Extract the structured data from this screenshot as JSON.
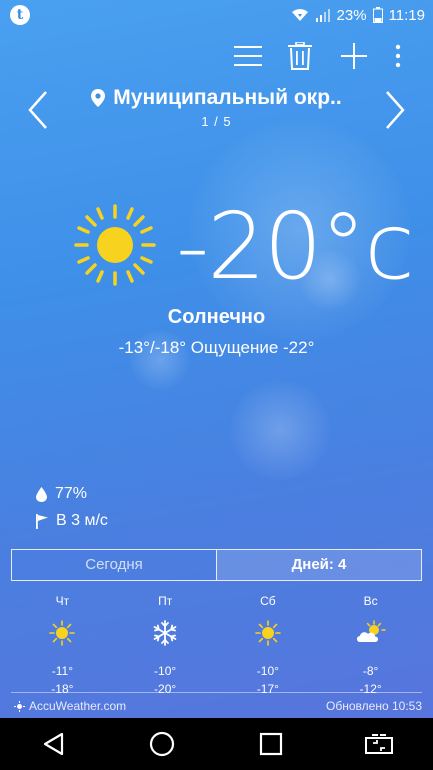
{
  "status_bar": {
    "app_badge": "t",
    "battery": "23%",
    "time": "11:19"
  },
  "location": {
    "name": "Муниципальный окр..",
    "page": "1 / 5"
  },
  "current": {
    "temperature": "-20°c",
    "condition": "Солнечно",
    "min_max_feel": "-13°/-18° Ощущение -22°",
    "humidity": "77%",
    "wind": "В 3 м/с"
  },
  "tabs": {
    "today": "Сегодня",
    "days": "Дней: 4"
  },
  "forecast": [
    {
      "day": "Чт",
      "icon": "sun-icon",
      "hi": "-11°",
      "lo": "-18°"
    },
    {
      "day": "Пт",
      "icon": "snowflake-icon",
      "hi": "-10°",
      "lo": "-20°"
    },
    {
      "day": "Сб",
      "icon": "sun-icon",
      "hi": "-10°",
      "lo": "-17°"
    },
    {
      "day": "Вс",
      "icon": "partly-cloudy-icon",
      "hi": "-8°",
      "lo": "-12°"
    }
  ],
  "footer": {
    "brand": "AccuWeather.com",
    "updated": "Обновлено 10:53"
  },
  "colors": {
    "sun": "#f7d21e",
    "background_top": "#4aa0f0",
    "background_bottom": "#5a73dc"
  }
}
